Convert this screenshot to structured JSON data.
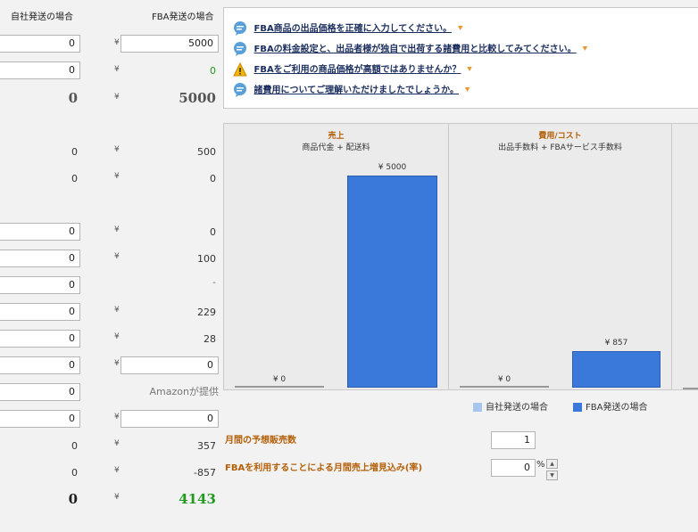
{
  "headers": {
    "self": "自社発送の場合",
    "fba": "FBA発送の場合"
  },
  "currency": "¥",
  "rows": [
    {
      "self": "0",
      "fba": "5000"
    },
    {
      "self": "0",
      "fba": "0"
    },
    {
      "self": "0",
      "fba": "5000"
    },
    {
      "self": "0",
      "fba": "500"
    },
    {
      "self": "0",
      "fba": "0"
    },
    {
      "self": "0",
      "fba": "0"
    },
    {
      "self": "0",
      "fba": "100"
    },
    {
      "self": "0",
      "fba": "-"
    },
    {
      "self": "0",
      "fba": "229"
    },
    {
      "self": "0",
      "fba": "28"
    },
    {
      "self": "0",
      "fba": "0"
    },
    {
      "self": "0",
      "fba": "Amazonが提供"
    },
    {
      "self": "0",
      "fba": "0"
    },
    {
      "self": "0",
      "fba": "357"
    },
    {
      "self": "0",
      "fba": "-857"
    },
    {
      "self": "0",
      "fba": "4143"
    }
  ],
  "tips": [
    {
      "text": "FBA商品の出品価格を正確に入力してください。",
      "icon": "speech-bubble-icon"
    },
    {
      "text": "FBAの料金設定と、出品者様が独自で出荷する諸費用と比較してみてください。",
      "icon": "speech-bubble-icon"
    },
    {
      "text": "FBAをご利用の商品価格が高額ではありませんか？",
      "icon": "warning-icon"
    },
    {
      "text": "諸費用についてご理解いただけましたでしょうか。",
      "icon": "speech-bubble-icon"
    }
  ],
  "chart_data": {
    "type": "bar",
    "panels": [
      {
        "title": "売上",
        "subtitle": "商品代金 + 配送料",
        "series": [
          {
            "name": "自社発送の場合",
            "value": 0,
            "label": "¥ 0"
          },
          {
            "name": "FBA発送の場合",
            "value": 5000,
            "label": "¥ 5000"
          }
        ]
      },
      {
        "title": "費用/コスト",
        "subtitle": "出品手数料 + FBAサービス手数料",
        "series": [
          {
            "name": "自社発送の場合",
            "value": 0,
            "label": "¥ 0"
          },
          {
            "name": "FBA発送の場合",
            "value": 857,
            "label": "¥ 857"
          }
        ]
      }
    ],
    "ymax": 5000,
    "colors": {
      "self": "#a7c6ee",
      "fba": "#3a78d9"
    },
    "legend": [
      "自社発送の場合",
      "FBA発送の場合"
    ]
  },
  "options": {
    "monthly_sales_label": "月間の予想販売数",
    "monthly_sales_value": "1",
    "increase_label": "FBAを利用することによる月間売上増見込み(率)",
    "increase_value": "0",
    "percent": "%"
  }
}
